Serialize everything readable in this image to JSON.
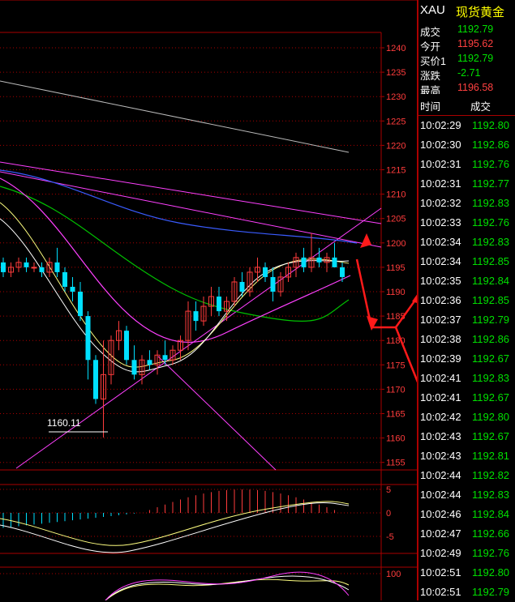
{
  "colors": {
    "up": "#ff3c3c",
    "down": "#00e0ff",
    "grid": "#aa0000",
    "price_green": "#00e000",
    "annotation_arrow": "#ff1a1a",
    "title_yellow": "#ffff00"
  },
  "header": {
    "symbol": "XAU",
    "name": "现货黄金"
  },
  "quote": {
    "rows": [
      {
        "label": "成交",
        "value": "1192.79",
        "color": "#00e000"
      },
      {
        "label": "今开",
        "value": "1195.62",
        "color": "#ff4040"
      },
      {
        "label": "买价1",
        "value": "1192.79",
        "color": "#00e000"
      },
      {
        "label": "涨跌",
        "value": "-2.71",
        "color": "#00e000"
      },
      {
        "label": "最高",
        "value": "1196.58",
        "color": "#ff4040"
      }
    ]
  },
  "ticks": {
    "header_time": "时间",
    "header_price": "成交",
    "rows": [
      {
        "time": "10:02:29",
        "price": "1192.80"
      },
      {
        "time": "10:02:30",
        "price": "1192.86"
      },
      {
        "time": "10:02:31",
        "price": "1192.76"
      },
      {
        "time": "10:02:31",
        "price": "1192.77"
      },
      {
        "time": "10:02:32",
        "price": "1192.83"
      },
      {
        "time": "10:02:33",
        "price": "1192.76"
      },
      {
        "time": "10:02:34",
        "price": "1192.83"
      },
      {
        "time": "10:02:34",
        "price": "1192.85"
      },
      {
        "time": "10:02:35",
        "price": "1192.84"
      },
      {
        "time": "10:02:36",
        "price": "1192.85"
      },
      {
        "time": "10:02:37",
        "price": "1192.79"
      },
      {
        "time": "10:02:38",
        "price": "1192.86"
      },
      {
        "time": "10:02:39",
        "price": "1192.67"
      },
      {
        "time": "10:02:41",
        "price": "1192.83"
      },
      {
        "time": "10:02:41",
        "price": "1192.67"
      },
      {
        "time": "10:02:42",
        "price": "1192.80"
      },
      {
        "time": "10:02:43",
        "price": "1192.67"
      },
      {
        "time": "10:02:43",
        "price": "1192.81"
      },
      {
        "time": "10:02:44",
        "price": "1192.82"
      },
      {
        "time": "10:02:44",
        "price": "1192.83"
      },
      {
        "time": "10:02:46",
        "price": "1192.84"
      },
      {
        "time": "10:02:47",
        "price": "1192.66"
      },
      {
        "time": "10:02:49",
        "price": "1192.76"
      },
      {
        "time": "10:02:51",
        "price": "1192.80"
      },
      {
        "time": "10:02:51",
        "price": "1192.79"
      }
    ]
  },
  "chart_data": {
    "type": "candlestick",
    "price_axis": {
      "ticks": [
        1240,
        1235,
        1230,
        1225,
        1220,
        1215,
        1210,
        1205,
        1200,
        1195,
        1190,
        1185,
        1180,
        1175,
        1170,
        1165,
        1160,
        1155
      ],
      "ylim": [
        1153,
        1242
      ]
    },
    "annotation": "1160.11",
    "candles": [
      {
        "o": 1196,
        "h": 1197,
        "l": 1193,
        "c": 1194
      },
      {
        "o": 1194,
        "h": 1196,
        "l": 1193,
        "c": 1195
      },
      {
        "o": 1195,
        "h": 1197,
        "l": 1194,
        "c": 1196
      },
      {
        "o": 1196,
        "h": 1197,
        "l": 1194,
        "c": 1195
      },
      {
        "o": 1195,
        "h": 1196,
        "l": 1194,
        "c": 1195
      },
      {
        "o": 1195,
        "h": 1196,
        "l": 1193,
        "c": 1194
      },
      {
        "o": 1194,
        "h": 1197,
        "l": 1193,
        "c": 1196
      },
      {
        "o": 1196,
        "h": 1199,
        "l": 1193,
        "c": 1194
      },
      {
        "o": 1194,
        "h": 1195,
        "l": 1190,
        "c": 1191
      },
      {
        "o": 1191,
        "h": 1193,
        "l": 1188,
        "c": 1190
      },
      {
        "o": 1190,
        "h": 1192,
        "l": 1184,
        "c": 1185
      },
      {
        "o": 1185,
        "h": 1186,
        "l": 1172,
        "c": 1176
      },
      {
        "o": 1176,
        "h": 1177,
        "l": 1167,
        "c": 1168
      },
      {
        "o": 1168,
        "h": 1180,
        "l": 1160.11,
        "c": 1173
      },
      {
        "o": 1173,
        "h": 1181,
        "l": 1171,
        "c": 1180
      },
      {
        "o": 1180,
        "h": 1184,
        "l": 1178,
        "c": 1182
      },
      {
        "o": 1182,
        "h": 1183,
        "l": 1175,
        "c": 1176
      },
      {
        "o": 1176,
        "h": 1179,
        "l": 1172,
        "c": 1173
      },
      {
        "o": 1173,
        "h": 1177,
        "l": 1171,
        "c": 1176
      },
      {
        "o": 1176,
        "h": 1178,
        "l": 1174,
        "c": 1175
      },
      {
        "o": 1175,
        "h": 1178,
        "l": 1173,
        "c": 1177
      },
      {
        "o": 1177,
        "h": 1180,
        "l": 1175,
        "c": 1176
      },
      {
        "o": 1176,
        "h": 1179,
        "l": 1175,
        "c": 1178
      },
      {
        "o": 1178,
        "h": 1181,
        "l": 1176,
        "c": 1180
      },
      {
        "o": 1180,
        "h": 1188,
        "l": 1178,
        "c": 1186
      },
      {
        "o": 1186,
        "h": 1188,
        "l": 1182,
        "c": 1184
      },
      {
        "o": 1184,
        "h": 1189,
        "l": 1183,
        "c": 1187
      },
      {
        "o": 1187,
        "h": 1191,
        "l": 1185,
        "c": 1189
      },
      {
        "o": 1189,
        "h": 1191,
        "l": 1185,
        "c": 1186
      },
      {
        "o": 1186,
        "h": 1189,
        "l": 1184,
        "c": 1188
      },
      {
        "o": 1188,
        "h": 1193,
        "l": 1187,
        "c": 1192
      },
      {
        "o": 1192,
        "h": 1194,
        "l": 1189,
        "c": 1190
      },
      {
        "o": 1190,
        "h": 1195,
        "l": 1189,
        "c": 1194
      },
      {
        "o": 1194,
        "h": 1197,
        "l": 1192,
        "c": 1195
      },
      {
        "o": 1195,
        "h": 1196,
        "l": 1192,
        "c": 1193
      },
      {
        "o": 1193,
        "h": 1195,
        "l": 1188,
        "c": 1190
      },
      {
        "o": 1190,
        "h": 1194,
        "l": 1189,
        "c": 1193
      },
      {
        "o": 1193,
        "h": 1196,
        "l": 1192,
        "c": 1195
      },
      {
        "o": 1195,
        "h": 1198,
        "l": 1193,
        "c": 1197
      },
      {
        "o": 1197,
        "h": 1199,
        "l": 1194,
        "c": 1195
      },
      {
        "o": 1195,
        "h": 1202,
        "l": 1194,
        "c": 1197
      },
      {
        "o": 1197,
        "h": 1199,
        "l": 1195,
        "c": 1196
      },
      {
        "o": 1196,
        "h": 1198,
        "l": 1194,
        "c": 1197
      },
      {
        "o": 1197,
        "h": 1200,
        "l": 1195,
        "c": 1195
      },
      {
        "o": 1195,
        "h": 1196,
        "l": 1192,
        "c": 1193
      }
    ],
    "macd_axis": {
      "ticks": [
        5,
        0,
        -5
      ],
      "ylim": [
        -8,
        7
      ]
    },
    "kdj_axis": {
      "ticks": [
        100
      ]
    }
  }
}
